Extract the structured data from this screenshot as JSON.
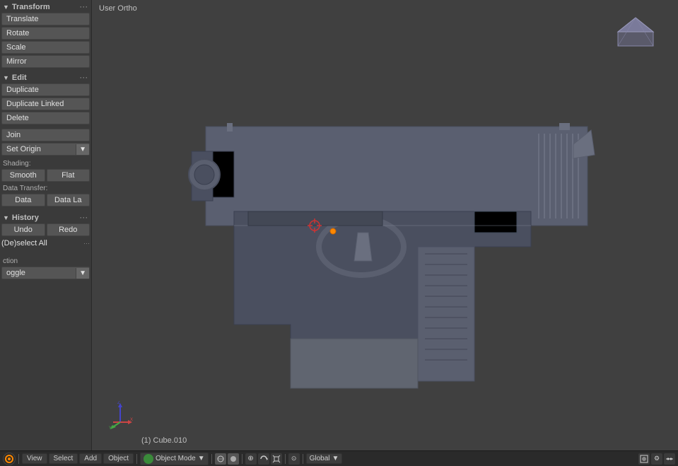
{
  "viewport": {
    "label": "User Ortho",
    "bottom_info": "(1) Cube.010"
  },
  "sidebar": {
    "transform_section": "Transform",
    "transform_dots": "···",
    "translate_label": "Translate",
    "rotate_label": "Rotate",
    "scale_label": "Scale",
    "mirror_label": "Mirror",
    "edit_section": "Edit",
    "edit_dots": "···",
    "duplicate_label": "Duplicate",
    "duplicate_linked_label": "Duplicate Linked",
    "delete_label": "Delete",
    "join_label": "Join",
    "set_origin_label": "Set Origin",
    "shading_label": "Shading:",
    "smooth_label": "Smooth",
    "flat_label": "Flat",
    "data_transfer_label": "Data Transfer:",
    "data_label": "Data",
    "data_la_label": "Data La",
    "history_section": "History",
    "history_dots": "···",
    "undo_label": "Undo",
    "redo_label": "Redo",
    "deselect_all_label": "(De)select All",
    "deselect_dots": "···",
    "ction_label": "ction",
    "oggle_label": "oggle"
  },
  "bottom_bar": {
    "view_label": "View",
    "select_label": "Select",
    "add_label": "Add",
    "object_label": "Object",
    "mode_label": "Object Mode",
    "global_label": "Global"
  },
  "icons": {
    "arrow_down": "▼",
    "arrow_right": "▶",
    "dots": "···",
    "sphere": "●",
    "circle": "○",
    "move": "⊕"
  }
}
